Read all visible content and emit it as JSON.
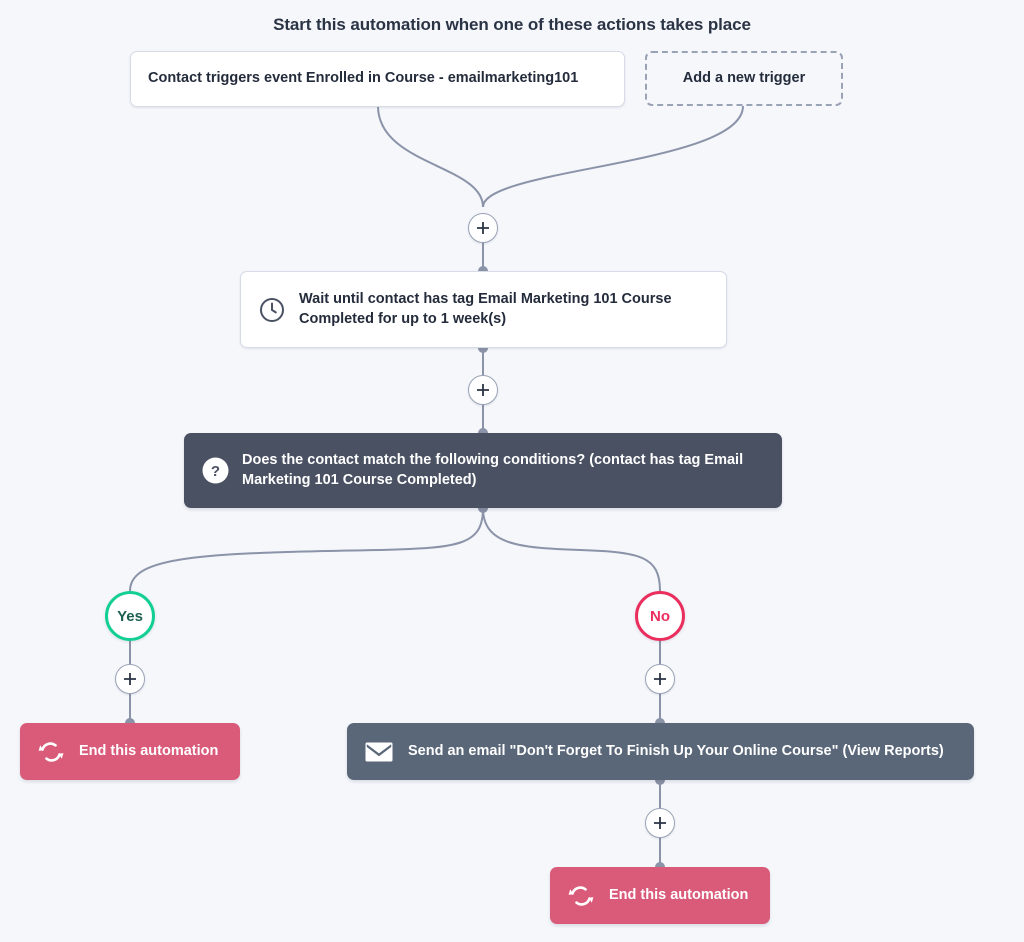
{
  "page": {
    "title": "Start this automation when one of these actions takes place",
    "background_color": "#f5f7fb"
  },
  "colors": {
    "background": "#f5f7fb",
    "wire": "#8b93a8",
    "trigger_card_bg": "#ffffff",
    "trigger_card_border": "#d7dbe6",
    "dashed_border": "#9aa2b6",
    "condition_bg": "#4a5163",
    "email_bg": "#5a6779",
    "end_bg": "#da5a79",
    "yes_border": "#14cf93",
    "yes_text": "#1c5f52",
    "no_border": "#ea2f5e",
    "no_text": "#ea2f5e",
    "plus_border": "#9aa3b6",
    "plus_glyph": "#2b3445"
  },
  "triggers": {
    "primary": {
      "label": "Contact triggers event Enrolled in Course - emailmarketing101"
    },
    "add": {
      "label": "Add a new trigger"
    }
  },
  "nodes": {
    "wait": {
      "icon": "clock-icon",
      "label": "Wait until contact has tag Email Marketing 101 Course Completed for up to 1 week(s)"
    },
    "condition": {
      "icon": "question-mark-icon",
      "label": "Does the contact match the following conditions? (contact has tag Email Marketing 101 Course Completed)"
    },
    "end_yes_branch": {
      "icon": "cycle-arrows-icon",
      "label": "End this automation"
    },
    "email": {
      "icon": "envelope-icon",
      "label": "Send an email \"Don't Forget To Finish Up Your Online Course\" (View Reports)"
    },
    "end_no_branch": {
      "icon": "cycle-arrows-icon",
      "label": "End this automation"
    }
  },
  "branches": {
    "yes": {
      "label": "Yes"
    },
    "no": {
      "label": "No"
    }
  },
  "add_buttons": {
    "after_triggers": {
      "label": "+"
    },
    "after_wait": {
      "label": "+"
    },
    "yes_branch": {
      "label": "+"
    },
    "no_branch": {
      "label": "+"
    },
    "after_email": {
      "label": "+"
    }
  }
}
